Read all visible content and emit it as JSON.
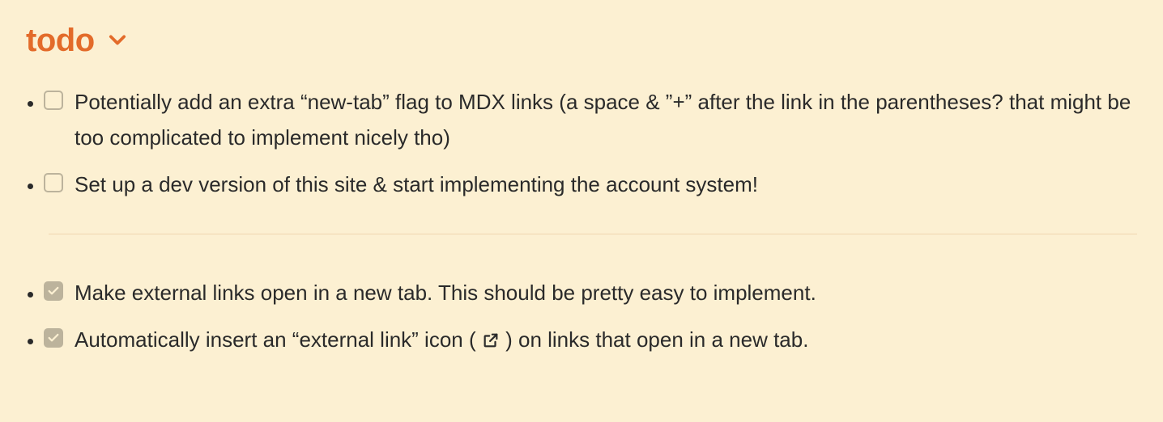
{
  "heading": "todo",
  "pending": [
    {
      "text": "Potentially add an extra “new-tab” flag to MDX links (a space & ”+” after the link in the parentheses? that might be too complicated to implement nicely tho)",
      "checked": false
    },
    {
      "text": "Set up a dev version of this site & start implementing the account system!",
      "checked": false
    }
  ],
  "done": [
    {
      "text": "Make external links open in a new tab. This should be pretty easy to implement.",
      "checked": true
    },
    {
      "text_before": "Automatically insert an “external link” icon ( ",
      "text_after": " ) on links that open in a new tab.",
      "checked": true
    }
  ]
}
